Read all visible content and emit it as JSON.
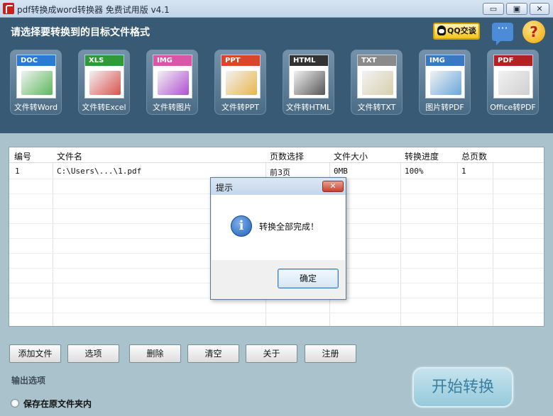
{
  "window": {
    "title": "pdf转换成word转换器 免费试用版 v4.1",
    "controls": {
      "minimize": "▭",
      "maximize": "▣",
      "close": "✕"
    }
  },
  "header": {
    "prompt": "请选择要转换到的目标文件格式",
    "qq_label": "QQ交谈",
    "chat_glyph": "···",
    "help_glyph": "?"
  },
  "formats": [
    {
      "tag": "DOC",
      "label": "文件转Word",
      "tag_color": "#2b7bd2",
      "art_color": "#5cb85c"
    },
    {
      "tag": "XLS",
      "label": "文件转Excel",
      "tag_color": "#2f9a3a",
      "art_color": "#d9534f"
    },
    {
      "tag": "IMG",
      "label": "文件转图片",
      "tag_color": "#d957a6",
      "art_color": "#b04fd0"
    },
    {
      "tag": "PPT",
      "label": "文件转PPT",
      "tag_color": "#d9462c",
      "art_color": "#e8b64a"
    },
    {
      "tag": "HTML",
      "label": "文件转HTML",
      "tag_color": "#333333",
      "art_color": "#555555"
    },
    {
      "tag": "TXT",
      "label": "文件转TXT",
      "tag_color": "#8a8a8a",
      "art_color": "#d8cfae"
    },
    {
      "tag": "IMG",
      "label": "图片转PDF",
      "tag_color": "#3a78c2",
      "art_color": "#6aa6dc"
    },
    {
      "tag": "PDF",
      "label": "Office转PDF",
      "tag_color": "#b32222",
      "art_color": "#cfcfcf"
    }
  ],
  "table": {
    "columns": [
      "编号",
      "文件名",
      "页数选择",
      "文件大小",
      "转换进度",
      "总页数"
    ],
    "rows": [
      {
        "index": "1",
        "filename": "C:\\Users\\...\\1.pdf",
        "pages": "前3页",
        "size": "0MB",
        "progress": "100%",
        "total": "1"
      }
    ]
  },
  "dialog": {
    "title": "提示",
    "close_glyph": "✕",
    "icon_glyph": "i",
    "message": "转换全部完成！",
    "ok_label": "确定"
  },
  "actions": {
    "add_file": "添加文件",
    "options": "选项",
    "delete": "删除",
    "clear": "清空",
    "about": "关于",
    "register": "注册"
  },
  "output": {
    "title": "输出选项",
    "option_same_folder": "保存在原文件夹内"
  },
  "start_button": "开始转换"
}
